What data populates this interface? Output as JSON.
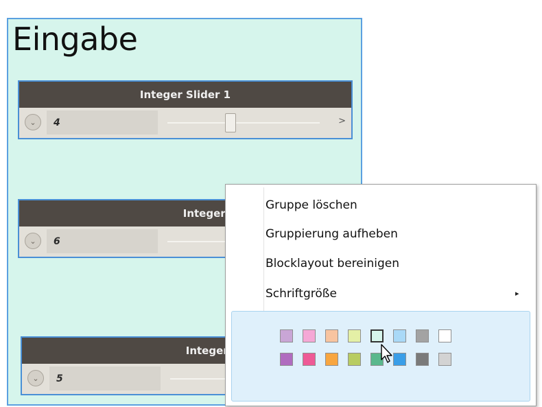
{
  "group": {
    "title": "Eingabe",
    "background": "#d6f5ec",
    "border": "#5aa0e0"
  },
  "nodes": [
    {
      "header": "Integer Slider 1",
      "value": "4",
      "slider_fraction": 0.4,
      "arrow": ">"
    },
    {
      "header": "Integer Slider",
      "value": "6"
    },
    {
      "header": "Integer Slider",
      "value": "5"
    }
  ],
  "context_menu": {
    "items": [
      {
        "label": "Gruppe löschen"
      },
      {
        "label": "Gruppierung aufheben"
      },
      {
        "label": "Blocklayout bereinigen"
      },
      {
        "label": "Schriftgröße",
        "submenu_arrow": "▸"
      }
    ],
    "colors": [
      [
        "#c9a6d6",
        "#f5a8d6",
        "#f8c4a0",
        "#e4f0a6",
        "#d6f5ec",
        "#a9d9f7",
        "#a3a3a3",
        "#ffffff"
      ],
      [
        "#b06cbf",
        "#ee5a96",
        "#f8a640",
        "#b8cc62",
        "#5ab88d",
        "#3a9ee8",
        "#7a7a7a",
        "#d3d3d3"
      ]
    ],
    "selected_color": "#d6f5ec"
  }
}
